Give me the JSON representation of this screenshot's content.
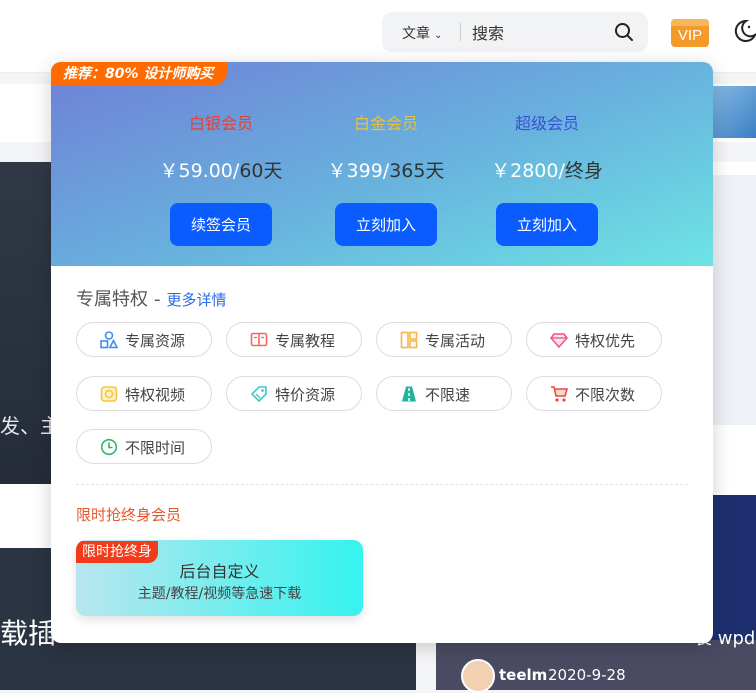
{
  "header": {
    "search_type": "文章",
    "search_placeholder": "搜索",
    "vip_label": "VIP"
  },
  "background": {
    "left_text_top": "发、主",
    "left_text_bottom": "载插",
    "right_text": "装 wpd",
    "author_name": "teelm",
    "post_date": "2020-9-28"
  },
  "popup": {
    "promo": "推荐：80% 设计师购买",
    "plans": [
      {
        "name": "白银会员",
        "price": "￥59.00",
        "period": "60天",
        "button": "续签会员",
        "color": "#e0443a"
      },
      {
        "name": "白金会员",
        "price": "￥399",
        "period": "365天",
        "button": "立刻加入",
        "color": "#e8c23a"
      },
      {
        "name": "超级会员",
        "price": "￥2800",
        "period": "终身",
        "button": "立刻加入",
        "color": "#3b4fd6"
      }
    ],
    "privilege_title": "专属特权",
    "separator": "-",
    "more_link": "更多详情",
    "privileges": [
      {
        "label": "专属资源",
        "icon": "shapes-icon",
        "color": "#3a8ff0"
      },
      {
        "label": "专属教程",
        "icon": "book-icon",
        "color": "#f06a5a"
      },
      {
        "label": "专属活动",
        "icon": "layout-icon",
        "color": "#f5b547"
      },
      {
        "label": "特权优先",
        "icon": "diamond-icon",
        "color": "#f0508a"
      },
      {
        "label": "特权视频",
        "icon": "video-icon",
        "color": "#f5c53a"
      },
      {
        "label": "特价资源",
        "icon": "tag-icon",
        "color": "#3fc6c6"
      },
      {
        "label": "不限速",
        "icon": "road-icon",
        "color": "#22b39b"
      },
      {
        "label": "不限次数",
        "icon": "cart-icon",
        "color": "#f0483a"
      },
      {
        "label": "不限时间",
        "icon": "clock-icon",
        "color": "#33b56a"
      }
    ],
    "limited_title": "限时抢终身会员",
    "limited_badge": "限时抢终身",
    "limited_main": "后台自定义",
    "limited_sub": "主题/教程/视频等急速下载"
  }
}
